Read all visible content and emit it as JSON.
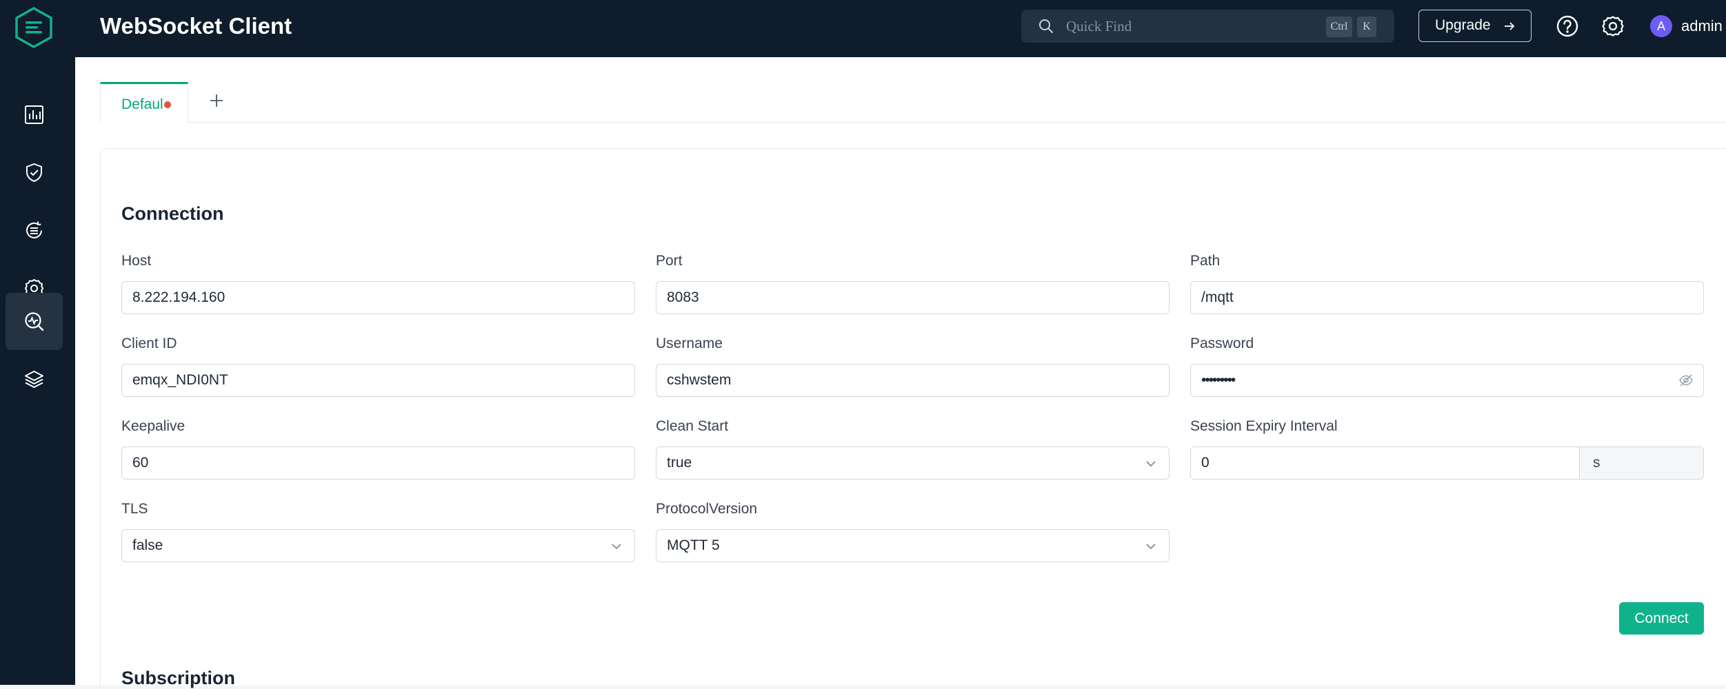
{
  "header": {
    "app_title": "WebSocket Client",
    "search_placeholder": "Quick Find",
    "shortcut_keys": [
      "Ctrl",
      "K"
    ],
    "upgrade_label": "Upgrade",
    "avatar_letter": "A",
    "user_name": "admin"
  },
  "sidebar": {
    "items": [
      {
        "icon": "dashboard-icon",
        "active": false
      },
      {
        "icon": "shield-check-icon",
        "active": false
      },
      {
        "icon": "integration-icon",
        "active": false
      },
      {
        "icon": "gear-icon",
        "active": false
      },
      {
        "icon": "diagnose-icon",
        "active": true
      },
      {
        "icon": "layers-icon",
        "active": false
      }
    ]
  },
  "tabs": [
    {
      "label": "Defaul",
      "active": true,
      "unsaved": true
    }
  ],
  "connection": {
    "title": "Connection",
    "host_label": "Host",
    "host_value": "8.222.194.160",
    "port_label": "Port",
    "port_value": "8083",
    "path_label": "Path",
    "path_value": "/mqtt",
    "client_id_label": "Client ID",
    "client_id_value": "emqx_NDI0NT",
    "username_label": "Username",
    "username_value": "cshwstem",
    "password_label": "Password",
    "password_value": "•••••••••",
    "keepalive_label": "Keepalive",
    "keepalive_value": "60",
    "clean_start_label": "Clean Start",
    "clean_start_value": "true",
    "session_expiry_label": "Session Expiry Interval",
    "session_expiry_value": "0",
    "session_expiry_unit": "s",
    "tls_label": "TLS",
    "tls_value": "false",
    "protocol_label": "ProtocolVersion",
    "protocol_value": "MQTT 5",
    "connect_label": "Connect"
  },
  "subscription": {
    "title": "Subscription"
  },
  "colors": {
    "sidebar_bg": "#0e1c2b",
    "accent": "#00a77b",
    "connect_button": "#10b28c",
    "unsaved_dot": "#f04a3c",
    "avatar": "#6d5bf6"
  }
}
